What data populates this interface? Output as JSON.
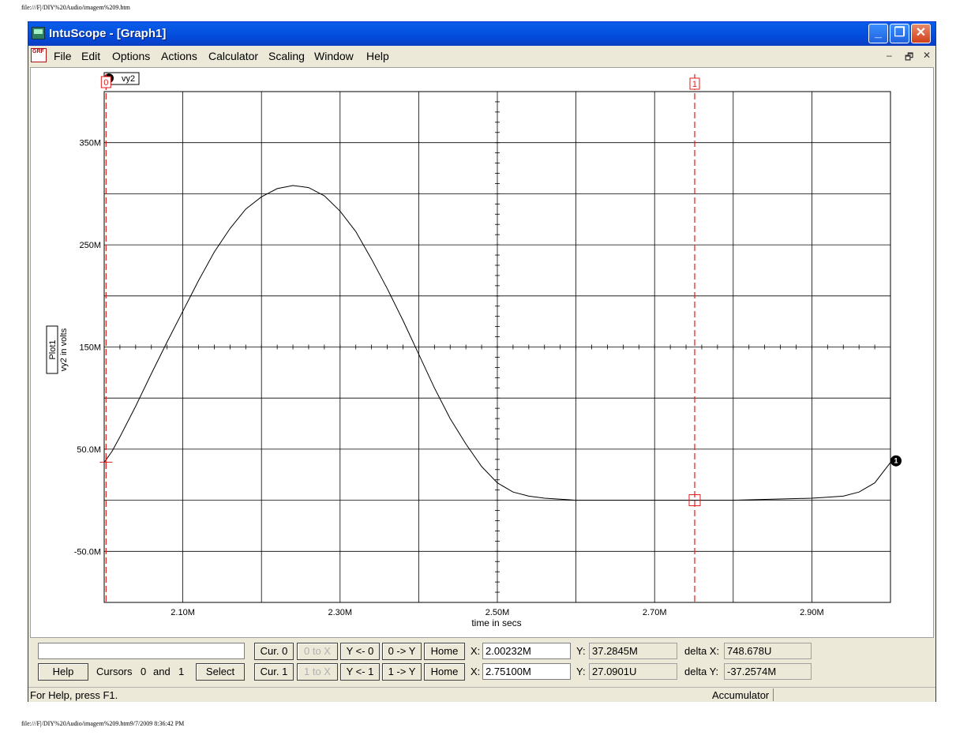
{
  "print_header": "file:///F|/DIY%20Audio/imagem%209.htm",
  "print_footer": "file:///F|/DIY%20Audio/imagem%209.htm9/7/2009 8:36:42 PM",
  "window": {
    "title": "IntuScope - [Graph1]",
    "menu_icon_text": "GRF",
    "menu": [
      "File",
      "Edit",
      "Options",
      "Actions",
      "Calculator",
      "Scaling",
      "Window",
      "Help"
    ]
  },
  "graph": {
    "legend_label": "vy2",
    "plot_label": "Plot1",
    "ylabel": "vy2 in volts",
    "xlabel": "time in secs",
    "cursor0_label": "0",
    "cursor1_label": "1",
    "trace_marker_label": "1"
  },
  "chart_data": {
    "type": "line",
    "title": "",
    "xlabel": "time in secs",
    "ylabel": "vy2 in volts",
    "x_ticks": [
      "2.10M",
      "2.30M",
      "2.50M",
      "2.70M",
      "2.90M"
    ],
    "y_ticks": [
      "-50.0M",
      "50.0M",
      "150M",
      "250M",
      "350M"
    ],
    "xlim": [
      2.0,
      3.0
    ],
    "ylim": [
      -100,
      400
    ],
    "series": [
      {
        "name": "vy2",
        "x": [
          2.0,
          2.01,
          2.02,
          2.04,
          2.06,
          2.08,
          2.1,
          2.12,
          2.14,
          2.16,
          2.18,
          2.2,
          2.22,
          2.24,
          2.26,
          2.28,
          2.3,
          2.32,
          2.34,
          2.36,
          2.38,
          2.4,
          2.42,
          2.44,
          2.46,
          2.48,
          2.5,
          2.52,
          2.54,
          2.56,
          2.58,
          2.6,
          2.65,
          2.7,
          2.75,
          2.8,
          2.85,
          2.9,
          2.92,
          2.94,
          2.96,
          2.98,
          3.0
        ],
        "y": [
          37,
          48,
          62,
          92,
          124,
          155,
          185,
          215,
          243,
          266,
          285,
          297,
          305,
          308,
          306,
          298,
          283,
          263,
          236,
          207,
          176,
          143,
          110,
          80,
          55,
          33,
          17,
          8,
          4,
          2,
          1,
          0,
          0,
          0,
          0,
          0,
          1,
          2,
          3,
          4,
          8,
          17,
          37
        ]
      }
    ],
    "cursors": [
      {
        "label": "0",
        "x": 2.00232,
        "y": 37.2845
      },
      {
        "label": "1",
        "x": 2.751,
        "y": 0.027
      }
    ]
  },
  "panel": {
    "help": "Help",
    "cursors_text": "Cursors",
    "cursor_a": "0",
    "and_text": "and",
    "cursor_b": "1",
    "select": "Select",
    "cur0": "Cur. 0",
    "cur1": "Cur. 1",
    "zero_to_x": "0 to X",
    "one_to_x": "1 to X",
    "y_from_0": "Y <- 0",
    "y_from_1": "Y <- 1",
    "zero_to_y": "0 -> Y",
    "one_to_y": "1 -> Y",
    "home": "Home",
    "x_label": "X:",
    "y_label": "Y:",
    "x0": "2.00232M",
    "x1": "2.75100M",
    "y0": "37.2845M",
    "y1": "27.0901U",
    "delta_x_label": "delta X:",
    "delta_y_label": "delta Y:",
    "delta_x": "748.678U",
    "delta_y": "-37.2574M"
  },
  "status": {
    "left": "For Help, press F1.",
    "right": "Accumulator"
  },
  "colors": {
    "cursor": "#e31b1b",
    "trace": "#000000",
    "titlebar": "#0553e0"
  }
}
